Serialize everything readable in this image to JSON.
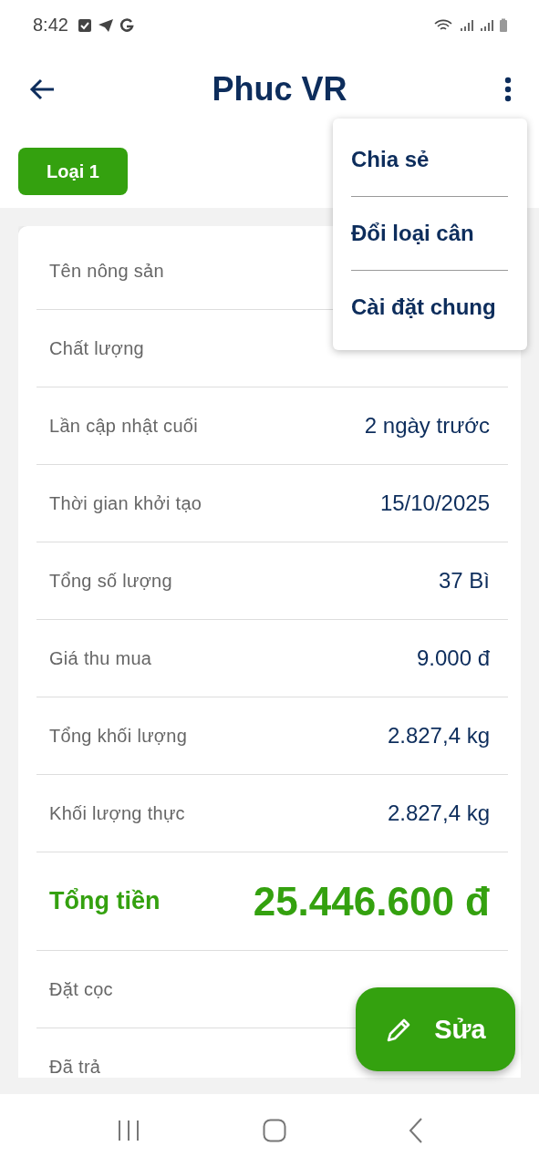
{
  "status_bar": {
    "time": "8:42"
  },
  "app_bar": {
    "title": "Phuc VR"
  },
  "tag": {
    "label": "Loại 1"
  },
  "rows": [
    {
      "kind": "plain",
      "label": "Tên nông sản"
    },
    {
      "kind": "plain",
      "label": "Chất lượng"
    },
    {
      "kind": "plain",
      "label": "Lần cập nhật cuối",
      "value": "2 ngày trước"
    },
    {
      "kind": "plain",
      "label": "Thời gian khởi tạo",
      "value": "15/10/2025"
    },
    {
      "kind": "plain",
      "label": "Tổng số lượng",
      "value": "37 Bì"
    },
    {
      "kind": "plain",
      "label": "Giá thu mua",
      "value": "9.000 đ"
    },
    {
      "kind": "plain",
      "label": "Tổng khối lượng",
      "value": "2.827,4 kg"
    },
    {
      "kind": "plain",
      "label": "Khối lượng thực",
      "value": "2.827,4 kg"
    },
    {
      "kind": "total",
      "label": "Tổng tiền",
      "value": "25.446.600 đ"
    },
    {
      "kind": "plain",
      "label": "Đặt cọc"
    },
    {
      "kind": "plain",
      "label": "Đã trả"
    }
  ],
  "menu": {
    "items": [
      "Chia sẻ",
      "Đổi loại cân",
      "Cài đặt chung"
    ]
  },
  "fab": {
    "label": "Sửa"
  }
}
